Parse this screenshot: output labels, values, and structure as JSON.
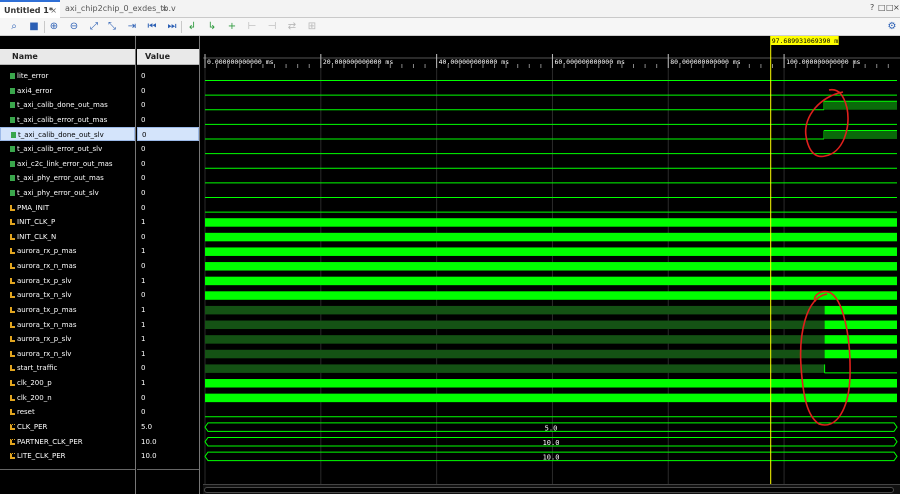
{
  "tabs": [
    {
      "label": "Untitled 1*",
      "active": true
    },
    {
      "label": "axi_chip2chip_0_exdes_tb.v",
      "active": false
    }
  ],
  "window_controls": [
    "?",
    "□",
    "□",
    "×"
  ],
  "toolbar_icons": [
    "search-icon",
    "save-icon",
    "zoom-in-icon",
    "zoom-out-icon",
    "zoom-fit-icon",
    "zoom-cursor-icon",
    "go-to-cursor-icon",
    "go-to-start-icon",
    "go-to-end-icon",
    "previous-transition-icon",
    "next-transition-icon",
    "add-marker-icon",
    "previous-marker-icon",
    "next-marker-icon",
    "swap-cursors-icon",
    "snap-icon"
  ],
  "columns": {
    "name": "Name",
    "value": "Value"
  },
  "signals": [
    {
      "name": "lite_error",
      "value": "0",
      "kind": "bus"
    },
    {
      "name": "axi4_error",
      "value": "0",
      "kind": "bus"
    },
    {
      "name": "t_axi_calib_done_out_mas",
      "value": "0",
      "kind": "bus"
    },
    {
      "name": "t_axi_calib_error_out_mas",
      "value": "0",
      "kind": "bus"
    },
    {
      "name": "t_axi_calib_done_out_slv",
      "value": "0",
      "kind": "bus",
      "selected": true
    },
    {
      "name": "t_axi_calib_error_out_slv",
      "value": "0",
      "kind": "bus"
    },
    {
      "name": "axi_c2c_link_error_out_mas",
      "value": "0",
      "kind": "bus"
    },
    {
      "name": "t_axi_phy_error_out_mas",
      "value": "0",
      "kind": "bus"
    },
    {
      "name": "t_axi_phy_error_out_slv",
      "value": "0",
      "kind": "bus"
    },
    {
      "name": "PMA_INIT",
      "value": "0",
      "kind": "wire"
    },
    {
      "name": "INIT_CLK_P",
      "value": "1",
      "kind": "wire"
    },
    {
      "name": "INIT_CLK_N",
      "value": "0",
      "kind": "wire"
    },
    {
      "name": "aurora_rx_p_mas",
      "value": "1",
      "kind": "wire"
    },
    {
      "name": "aurora_rx_n_mas",
      "value": "0",
      "kind": "wire"
    },
    {
      "name": "aurora_tx_p_slv",
      "value": "1",
      "kind": "wire"
    },
    {
      "name": "aurora_tx_n_slv",
      "value": "0",
      "kind": "wire"
    },
    {
      "name": "aurora_tx_p_mas",
      "value": "1",
      "kind": "wire"
    },
    {
      "name": "aurora_tx_n_mas",
      "value": "1",
      "kind": "wire"
    },
    {
      "name": "aurora_rx_p_slv",
      "value": "1",
      "kind": "wire"
    },
    {
      "name": "aurora_rx_n_slv",
      "value": "1",
      "kind": "wire"
    },
    {
      "name": "start_traffic",
      "value": "0",
      "kind": "wire"
    },
    {
      "name": "clk_200_p",
      "value": "1",
      "kind": "wire"
    },
    {
      "name": "clk_200_n",
      "value": "0",
      "kind": "wire"
    },
    {
      "name": "reset",
      "value": "0",
      "kind": "wire"
    },
    {
      "name": "CLK_PER",
      "value": "5.0",
      "kind": "real"
    },
    {
      "name": "PARTNER_CLK_PER",
      "value": "10.0",
      "kind": "real"
    },
    {
      "name": "LITE_CLK_PER",
      "value": "10.0",
      "kind": "real"
    }
  ],
  "timeline": {
    "ticks": [
      {
        "t": 0,
        "label": "0.000000000000 ms"
      },
      {
        "t": 20,
        "label": "20.000000000000 ms"
      },
      {
        "t": 40,
        "label": "40.000000000000 ms"
      },
      {
        "t": 60,
        "label": "60.000000000000 ms"
      },
      {
        "t": 80,
        "label": "80.000000000000 ms"
      },
      {
        "t": 100,
        "label": "100.000000000000 ms"
      }
    ],
    "cursor_t": 97.68993106939,
    "cursor_label": "97.689931069390 ms",
    "visible_end_t": 119.5
  },
  "waveforms": [
    {
      "type": "const",
      "level": 0
    },
    {
      "type": "const",
      "level": 0
    },
    {
      "type": "step",
      "from": 0,
      "to": 1,
      "at": 106.9
    },
    {
      "type": "const",
      "level": 0
    },
    {
      "type": "step",
      "from": 0,
      "to": 1,
      "at": 106.9
    },
    {
      "type": "const",
      "level": 0
    },
    {
      "type": "const",
      "level": 0
    },
    {
      "type": "const",
      "level": 0
    },
    {
      "type": "const",
      "level": 0
    },
    {
      "type": "const",
      "level": 0
    },
    {
      "type": "clock"
    },
    {
      "type": "clock"
    },
    {
      "type": "clock"
    },
    {
      "type": "clock"
    },
    {
      "type": "clock"
    },
    {
      "type": "clock"
    },
    {
      "type": "pending-then-clock",
      "at": 107
    },
    {
      "type": "pending-then-clock",
      "at": 107
    },
    {
      "type": "pending-then-clock",
      "at": 107
    },
    {
      "type": "pending-then-clock",
      "at": 107
    },
    {
      "type": "pending-then-const",
      "at": 107,
      "level": 0
    },
    {
      "type": "clock"
    },
    {
      "type": "clock"
    },
    {
      "type": "const",
      "level": 0
    },
    {
      "type": "bus",
      "text": "5.0"
    },
    {
      "type": "bus",
      "text": "10.0"
    },
    {
      "type": "bus",
      "text": "10.0"
    }
  ],
  "annotations": [
    {
      "kind": "hand-drawn-ellipse",
      "around": "t_axi_calib_done transitions"
    },
    {
      "kind": "hand-drawn-ellipse",
      "around": "aurora lanes and start_traffic transitions"
    }
  ],
  "colors": {
    "wave": "#00ff00",
    "wave_dark": "#0a6a0a",
    "pending": "#145214",
    "cursor": "#ffff00",
    "annotation": "#e0201c",
    "selection": "#d4e4fb"
  }
}
